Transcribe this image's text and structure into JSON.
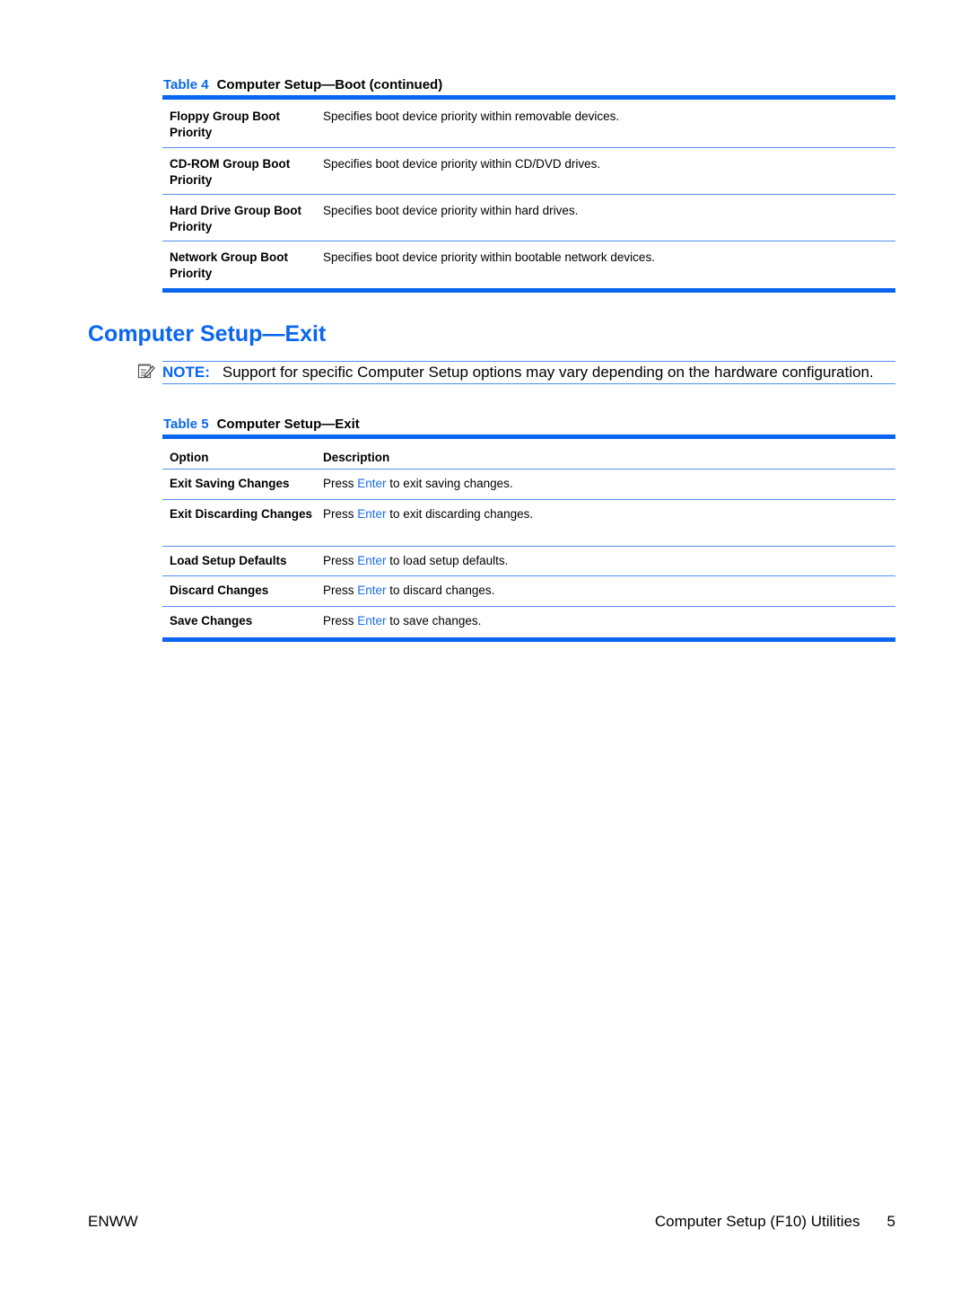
{
  "table4": {
    "number_label": "Table 4",
    "title": "Computer Setup—Boot (continued)",
    "rows": [
      {
        "option": "Floppy Group Boot Priority",
        "description": "Specifies boot device priority within removable devices."
      },
      {
        "option": "CD-ROM Group Boot Priority",
        "description": "Specifies boot device priority within CD/DVD drives."
      },
      {
        "option": "Hard Drive Group Boot Priority",
        "description": "Specifies boot device priority within hard drives."
      },
      {
        "option": "Network Group Boot Priority",
        "description": "Specifies boot device priority within bootable network devices."
      }
    ]
  },
  "section": {
    "title": "Computer Setup—Exit"
  },
  "note": {
    "icon": "note-pencil-icon",
    "label": "NOTE:",
    "text": "Support for specific Computer Setup options may vary depending on the hardware configuration."
  },
  "table5": {
    "number_label": "Table 5",
    "title": "Computer Setup—Exit",
    "headers": {
      "option": "Option",
      "description": "Description"
    },
    "rows": [
      {
        "option": "Exit Saving Changes",
        "pre": "Press ",
        "key": "Enter",
        "post": " to exit saving changes."
      },
      {
        "option": "Exit Discarding Changes",
        "pre": "Press ",
        "key": "Enter",
        "post": " to exit discarding changes."
      },
      {
        "option": "Load Setup Defaults",
        "pre": "Press ",
        "key": "Enter",
        "post": " to load setup defaults."
      },
      {
        "option": "Discard Changes",
        "pre": "Press ",
        "key": "Enter",
        "post": " to discard changes."
      },
      {
        "option": "Save Changes",
        "pre": "Press ",
        "key": "Enter",
        "post": " to save changes."
      }
    ]
  },
  "footer": {
    "left": "ENWW",
    "title": "Computer Setup (F10) Utilities",
    "page": "5"
  },
  "colors": {
    "accent": "#0a66f0",
    "rule": "#4f8ff0"
  }
}
